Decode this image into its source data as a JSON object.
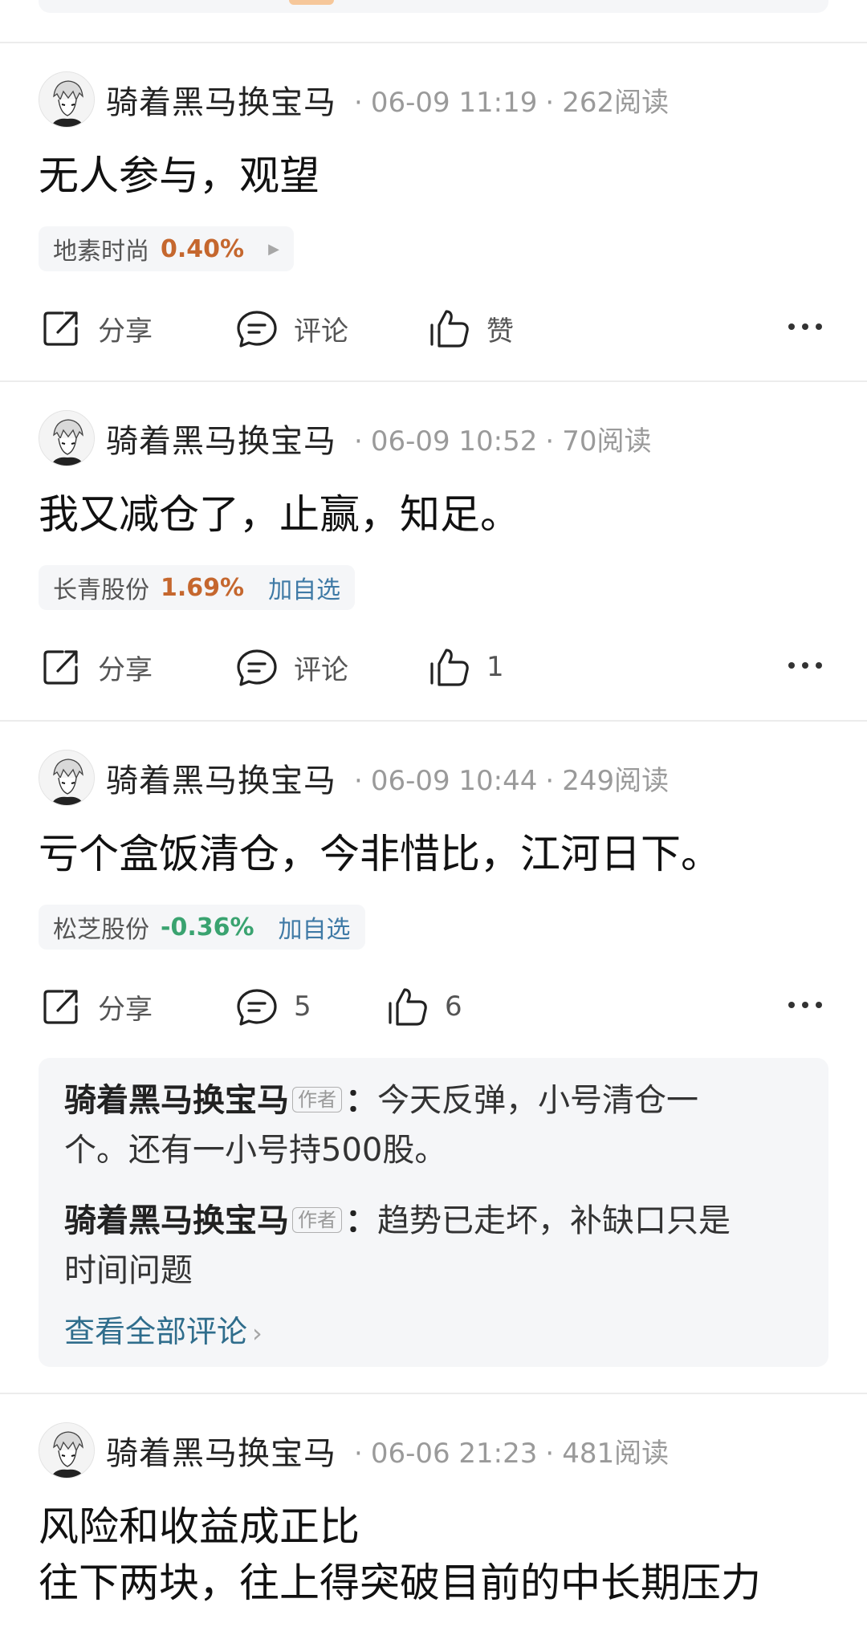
{
  "posts": [
    {
      "username": "骑着黑马换宝马",
      "datetime": "06-09 11:19",
      "reads": "262阅读",
      "content": "无人参与，观望",
      "stock": {
        "name": "地素时尚",
        "change": "0.40%",
        "add": ""
      },
      "actions": {
        "share": "分享",
        "comment": "评论",
        "like": "赞"
      }
    },
    {
      "username": "骑着黑马换宝马",
      "datetime": "06-09 10:52",
      "reads": "70阅读",
      "content": "我又减仓了，止赢，知足。",
      "stock": {
        "name": "长青股份",
        "change": "1.69%",
        "add": "加自选"
      },
      "actions": {
        "share": "分享",
        "comment": "评论",
        "like": "1"
      }
    },
    {
      "username": "骑着黑马换宝马",
      "datetime": "06-09 10:44",
      "reads": "249阅读",
      "content": "亏个盒饭清仓，今非惜比，江河日下。",
      "stock": {
        "name": "松芝股份",
        "change": "-0.36%",
        "add": "加自选"
      },
      "actions": {
        "share": "分享",
        "comment": "5",
        "like": "6"
      },
      "comments": [
        {
          "user": "骑着黑马换宝马",
          "badge": "作者",
          "line1": "今天反弹，小号清仓一",
          "line2": "个。还有一小号持500股。"
        },
        {
          "user": "骑着黑马换宝马",
          "badge": "作者",
          "line1": "趋势已走坏，补缺口只是",
          "line2": "时间问题"
        }
      ],
      "view_all": "查看全部评论"
    },
    {
      "username": "骑着黑马换宝马",
      "datetime": "06-06 21:23",
      "reads": "481阅读",
      "content_line1": "风险和收益成正比",
      "content_line2": "往下两块，往上得突破目前的中长期压力"
    }
  ],
  "colors": {
    "up": "#c5672e",
    "down": "#3aa370",
    "link": "#2f6d8c",
    "add": "#3f7aa6"
  },
  "icons": {
    "share": "share-icon",
    "comment": "comment-icon",
    "like": "thumbs-up-icon",
    "more": "more-icon",
    "arrow": "play-arrow-icon",
    "chevron": "chevron-right-icon"
  }
}
